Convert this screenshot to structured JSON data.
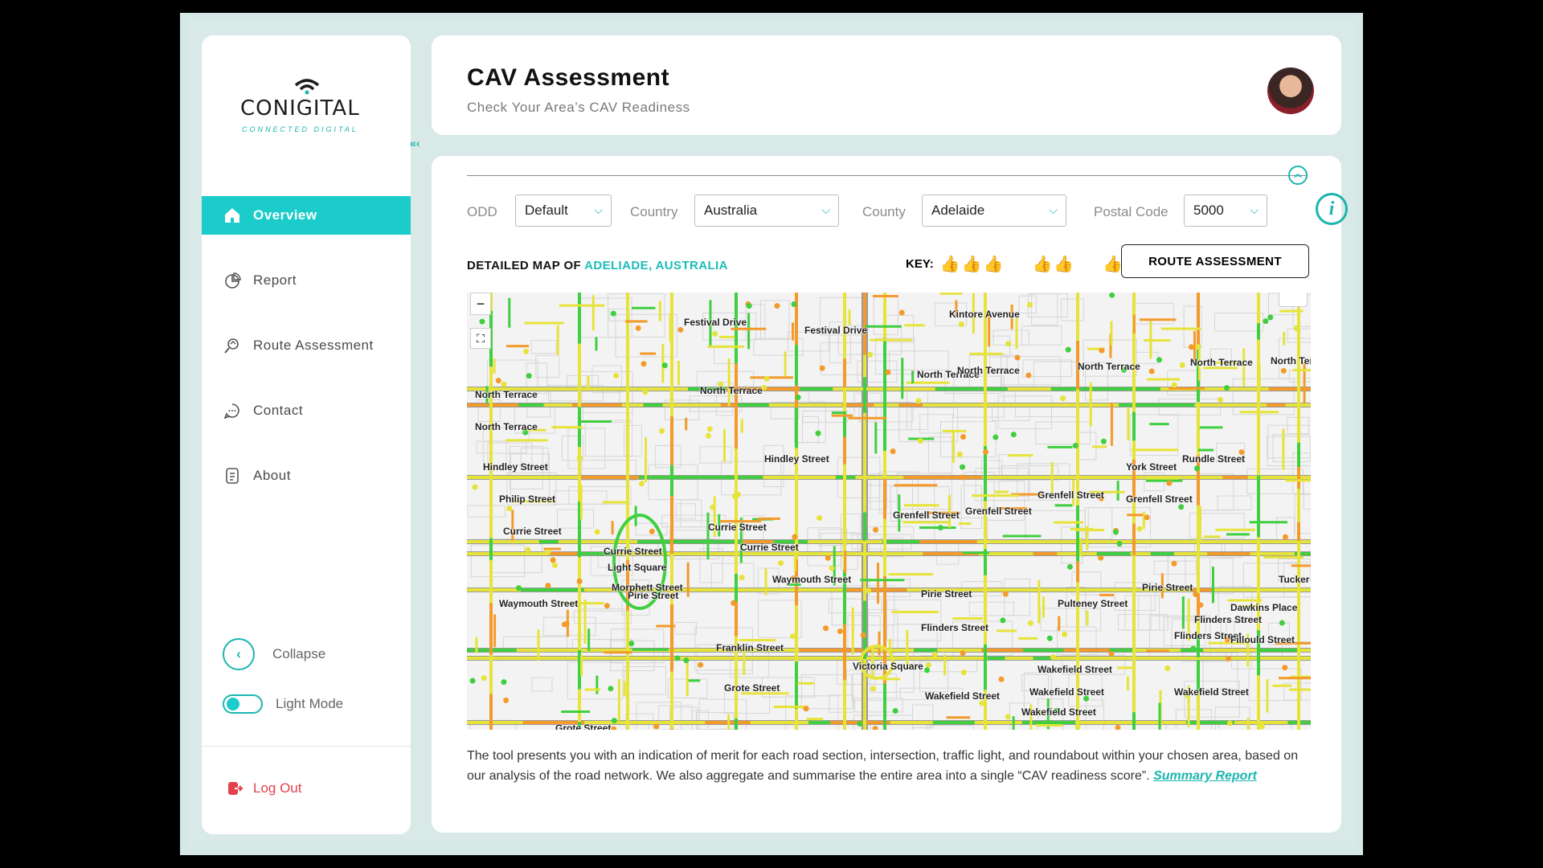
{
  "brand": {
    "logo_text": "CONIGITAL",
    "logo_sub": "CONNECTED DIGITAL",
    "accent": "#1bcccb"
  },
  "sidebar": {
    "collapse_tab_icon": "«‹",
    "items": [
      {
        "label": "Overview",
        "icon": "home-icon",
        "active": true
      },
      {
        "label": "Report",
        "icon": "pie-chart-icon",
        "active": false
      },
      {
        "label": "Route Assessment",
        "icon": "route-search-icon",
        "active": false
      },
      {
        "label": "Contact",
        "icon": "chat-icon",
        "active": false
      },
      {
        "label": "About",
        "icon": "document-icon",
        "active": false
      }
    ],
    "collapse_label": "Collapse",
    "light_mode_label": "Light Mode",
    "logout_label": "Log Out"
  },
  "header": {
    "title": "CAV Assessment",
    "subtitle": "Check Your Area’s CAV Readiness"
  },
  "filters": {
    "odd_label": "ODD",
    "odd_value": "Default",
    "country_label": "Country",
    "country_value": "Australia",
    "county_label": "County",
    "county_value": "Adelaide",
    "postal_label": "Postal Code",
    "postal_value": "5000"
  },
  "map_section": {
    "title_prefix": "DETAILED MAP OF ",
    "title_place": "ADELIADE, AUSTRALIA",
    "key_label": "KEY:",
    "route_button": "ROUTE ASSESSMENT",
    "key_colors": {
      "high": "#3fcf3f",
      "medium": "#e6e33a",
      "low": "#f39a2b"
    }
  },
  "map": {
    "zoom_in": "+",
    "zoom_out": "−",
    "fullscreen_icon": "⛶",
    "streets": [
      "Festival Drive",
      "Festival Drive",
      "Kintore Avenue",
      "North Terrace",
      "North Terrace",
      "North Terrace",
      "North Terrace",
      "North Terrace",
      "North Terrace",
      "North Terrace",
      "North Terrace",
      "Hindley Street",
      "Hindley Street",
      "Philip Street",
      "Currie Street",
      "Currie Street",
      "Currie Street",
      "Currie Street",
      "Light Square",
      "Grenfell Street",
      "Grenfell Street",
      "Grenfell Street",
      "Grenfell Street",
      "Waymouth Street",
      "Waymouth Street",
      "Pirie Street",
      "Pirie Street",
      "Pirie Street",
      "Flinders Street",
      "Flinders Street",
      "Franklin Street",
      "Grote Street",
      "Grote Street",
      "Victoria Square",
      "Wakefield Street",
      "Wakefield Street",
      "Wakefield Street",
      "Wakefield Street",
      "Wakefield Street",
      "York Street",
      "Rundle Street",
      "Tucker Street",
      "Dawkins Place",
      "Morphett Street",
      "Pulteney Street",
      "Flinders Street",
      "Fillould Street"
    ]
  },
  "description": {
    "text": "The tool presents you with an indication of merit for each road section, intersection, traffic light, and roundabout within your chosen area, based on our analysis of the road network. We also aggregate and summarise the entire area into a single “CAV readiness score”. ",
    "link": "Summary Report"
  }
}
